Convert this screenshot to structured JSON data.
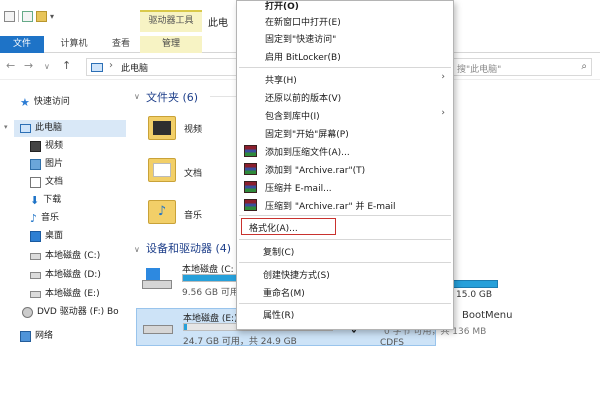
{
  "ribbon": {
    "context_tab": "驱动器工具",
    "title_partial": "此电",
    "tabs": [
      "文件",
      "计算机",
      "查看",
      "管理"
    ]
  },
  "address": {
    "breadcrumb": "此电脑",
    "search_placeholder": "搜\"此电脑\""
  },
  "sidebar": {
    "items": [
      {
        "label": "快速访问",
        "icon": "star-icon"
      },
      {
        "label": "此电脑",
        "icon": "computer-icon"
      },
      {
        "label": "视频",
        "icon": "video-folder-icon"
      },
      {
        "label": "图片",
        "icon": "pictures-folder-icon"
      },
      {
        "label": "文档",
        "icon": "documents-folder-icon"
      },
      {
        "label": "下载",
        "icon": "download-icon"
      },
      {
        "label": "音乐",
        "icon": "music-icon"
      },
      {
        "label": "桌面",
        "icon": "desktop-icon"
      },
      {
        "label": "本地磁盘 (C:)",
        "icon": "drive-icon"
      },
      {
        "label": "本地磁盘 (D:)",
        "icon": "drive-icon"
      },
      {
        "label": "本地磁盘 (E:)",
        "icon": "drive-icon"
      },
      {
        "label": "DVD 驱动器 (F:) Bo",
        "icon": "dvd-icon"
      },
      {
        "label": "网络",
        "icon": "network-icon"
      }
    ]
  },
  "content": {
    "folders_header": "文件夹 (6)",
    "folders": [
      "视频",
      "文档",
      "音乐"
    ],
    "devices_header": "设备和驱动器 (4)",
    "drives": [
      {
        "name": "本地磁盘 (C:",
        "size": "9.56 GB 可用，共",
        "used_fraction": 0.55
      },
      {
        "name": "本地磁盘 (E:)",
        "size": "24.7 GB 可用，共 24.9 GB",
        "used_fraction": 0.02
      }
    ],
    "right_size": "15.0 GB",
    "boot_label": "BootMenu",
    "boot_meta": "0 字节 可用，共 136 MB",
    "boot_fs": "CDFS"
  },
  "context_menu": {
    "items": [
      {
        "label": "打开(O)",
        "bold": true
      },
      {
        "label": "在新窗口中打开(E)"
      },
      {
        "label": "固定到\"快速访问\""
      },
      {
        "label": "启用 BitLocker(B)"
      },
      {
        "label": "共享(H)",
        "submenu": true
      },
      {
        "label": "还原以前的版本(V)"
      },
      {
        "label": "包含到库中(I)",
        "submenu": true
      },
      {
        "label": "固定到\"开始\"屏幕(P)"
      },
      {
        "label": "添加到压缩文件(A)...",
        "icon": "winrar-icon"
      },
      {
        "label": "添加到 \"Archive.rar\"(T)",
        "icon": "winrar-icon"
      },
      {
        "label": "压缩并 E-mail...",
        "icon": "winrar-icon"
      },
      {
        "label": "压缩到 \"Archive.rar\" 并 E-mail",
        "icon": "winrar-icon"
      },
      {
        "label": "格式化(A)...",
        "highlighted": true
      },
      {
        "label": "复制(C)"
      },
      {
        "label": "创建快捷方式(S)"
      },
      {
        "label": "重命名(M)"
      },
      {
        "label": "属性(R)"
      }
    ],
    "submenu_arrow": "›"
  },
  "colors": {
    "accent": "#1e73c7",
    "context_tab": "#f7f3c4",
    "drive_bar": "#26a0da",
    "highlight_box": "#c9322e",
    "selection": "#cde3f7"
  }
}
